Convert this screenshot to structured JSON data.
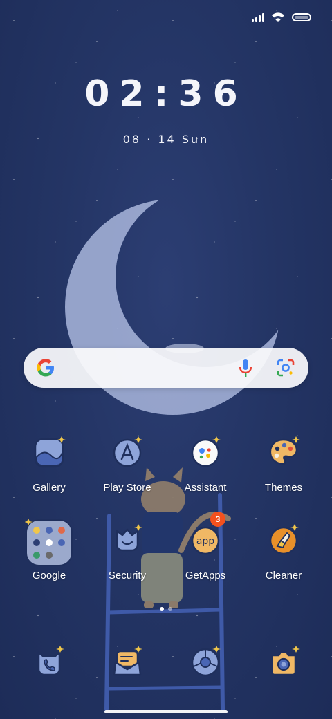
{
  "status_bar": {
    "signal_icon": "signal-icon",
    "wifi_icon": "wifi-icon",
    "battery_icon": "battery-icon"
  },
  "clock": {
    "time": "02:36",
    "date": "08 · 14  Sun"
  },
  "search_bar": {
    "google_icon": "google-g-icon",
    "mic_icon": "mic-icon",
    "lens_icon": "lens-icon"
  },
  "apps": [
    {
      "label": "Gallery",
      "icon": "gallery-icon"
    },
    {
      "label": "Play Store",
      "icon": "play-store-icon"
    },
    {
      "label": "Assistant",
      "icon": "assistant-icon"
    },
    {
      "label": "Themes",
      "icon": "themes-icon"
    },
    {
      "label": "Google",
      "icon": "google-folder-icon"
    },
    {
      "label": "Security",
      "icon": "security-icon"
    },
    {
      "label": "GetApps",
      "icon": "getapps-icon",
      "badge": "3"
    },
    {
      "label": "Cleaner",
      "icon": "cleaner-icon"
    }
  ],
  "getapps_icon_text": "app",
  "dock": [
    {
      "icon": "phone-icon"
    },
    {
      "icon": "messages-icon"
    },
    {
      "icon": "browser-icon"
    },
    {
      "icon": "camera-icon"
    }
  ],
  "colors": {
    "wallpaper": "#243565",
    "accent": "#f4511e",
    "icon_fill": "#8ea4d9"
  }
}
